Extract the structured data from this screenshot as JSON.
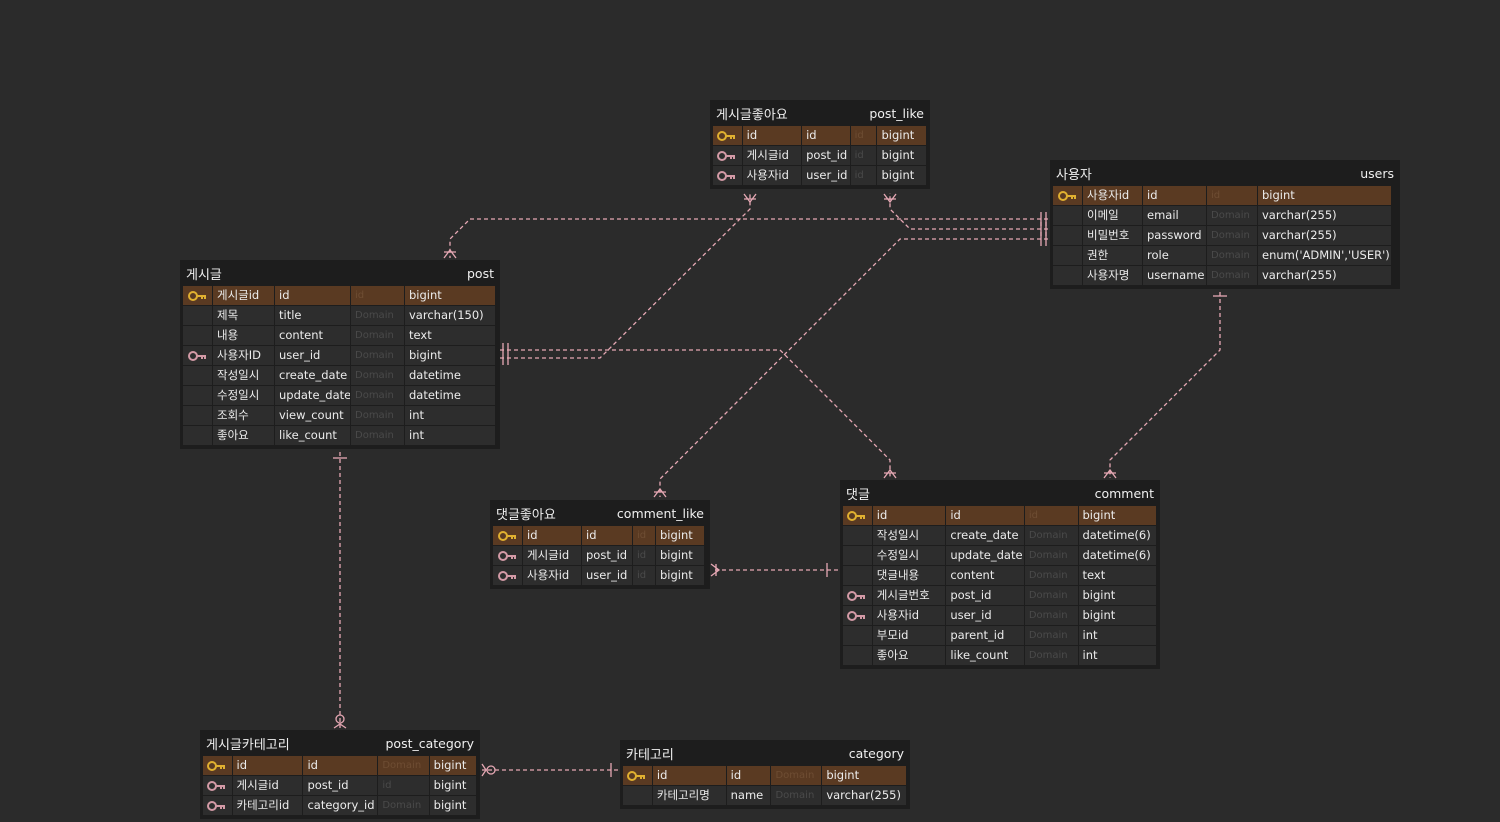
{
  "colors": {
    "background": "#2b2b2b",
    "pk_row": "#5a3a22",
    "relation_line": "#e6a8b4",
    "primary_key_icon": "#e0b030",
    "foreign_key_icon": "#d39aa6"
  },
  "icons": {
    "primary_key": "key-icon",
    "foreign_key": "foreign-key-icon"
  },
  "tables": [
    {
      "id": "post_like",
      "logical": "게시글좋아요",
      "physical": "post_like",
      "columns": [
        {
          "key": "pk",
          "logical": "id",
          "physical": "id",
          "domain": "id",
          "type": "bigint"
        },
        {
          "key": "fk",
          "logical": "게시글id",
          "physical": "post_id",
          "domain": "id",
          "type": "bigint"
        },
        {
          "key": "fk",
          "logical": "사용자id",
          "physical": "user_id",
          "domain": "id",
          "type": "bigint"
        }
      ]
    },
    {
      "id": "users",
      "logical": "사용자",
      "physical": "users",
      "columns": [
        {
          "key": "pk",
          "logical": "사용자id",
          "physical": "id",
          "domain": "id",
          "type": "bigint"
        },
        {
          "key": "",
          "logical": "이메일",
          "physical": "email",
          "domain": "Domain",
          "type": "varchar(255)"
        },
        {
          "key": "",
          "logical": "비밀번호",
          "physical": "password",
          "domain": "Domain",
          "type": "varchar(255)"
        },
        {
          "key": "",
          "logical": "권한",
          "physical": "role",
          "domain": "Domain",
          "type": "enum('ADMIN','USER')"
        },
        {
          "key": "",
          "logical": "사용자명",
          "physical": "username",
          "domain": "Domain",
          "type": "varchar(255)"
        }
      ]
    },
    {
      "id": "post",
      "logical": "게시글",
      "physical": "post",
      "columns": [
        {
          "key": "pk",
          "logical": "게시글id",
          "physical": "id",
          "domain": "id",
          "type": "bigint"
        },
        {
          "key": "",
          "logical": "제목",
          "physical": "title",
          "domain": "Domain",
          "type": "varchar(150)"
        },
        {
          "key": "",
          "logical": "내용",
          "physical": "content",
          "domain": "Domain",
          "type": "text"
        },
        {
          "key": "fk",
          "logical": "사용자ID",
          "physical": "user_id",
          "domain": "Domain",
          "type": "bigint"
        },
        {
          "key": "",
          "logical": "작성일시",
          "physical": "create_date",
          "domain": "Domain",
          "type": "datetime"
        },
        {
          "key": "",
          "logical": "수정일시",
          "physical": "update_date",
          "domain": "Domain",
          "type": "datetime"
        },
        {
          "key": "",
          "logical": "조회수",
          "physical": "view_count",
          "domain": "Domain",
          "type": "int"
        },
        {
          "key": "",
          "logical": "좋아요",
          "physical": "like_count",
          "domain": "Domain",
          "type": "int"
        }
      ]
    },
    {
      "id": "comment_like",
      "logical": "댓글좋아요",
      "physical": "comment_like",
      "columns": [
        {
          "key": "pk",
          "logical": "id",
          "physical": "id",
          "domain": "id",
          "type": "bigint"
        },
        {
          "key": "fk",
          "logical": "게시글id",
          "physical": "post_id",
          "domain": "id",
          "type": "bigint"
        },
        {
          "key": "fk",
          "logical": "사용자id",
          "physical": "user_id",
          "domain": "id",
          "type": "bigint"
        }
      ]
    },
    {
      "id": "comment",
      "logical": "댓글",
      "physical": "comment",
      "columns": [
        {
          "key": "pk",
          "logical": "id",
          "physical": "id",
          "domain": "id",
          "type": "bigint"
        },
        {
          "key": "",
          "logical": "작성일시",
          "physical": "create_date",
          "domain": "Domain",
          "type": "datetime(6)"
        },
        {
          "key": "",
          "logical": "수정일시",
          "physical": "update_date",
          "domain": "Domain",
          "type": "datetime(6)"
        },
        {
          "key": "",
          "logical": "댓글내용",
          "physical": "content",
          "domain": "Domain",
          "type": "text"
        },
        {
          "key": "fk",
          "logical": "게시글번호",
          "physical": "post_id",
          "domain": "Domain",
          "type": "bigint"
        },
        {
          "key": "fk",
          "logical": "사용자id",
          "physical": "user_id",
          "domain": "Domain",
          "type": "bigint"
        },
        {
          "key": "",
          "logical": "부모id",
          "physical": "parent_id",
          "domain": "Domain",
          "type": "int"
        },
        {
          "key": "",
          "logical": "좋아요",
          "physical": "like_count",
          "domain": "Domain",
          "type": "int"
        }
      ]
    },
    {
      "id": "post_category",
      "logical": "게시글카테고리",
      "physical": "post_category",
      "columns": [
        {
          "key": "pk",
          "logical": "id",
          "physical": "id",
          "domain": "Domain",
          "type": "bigint"
        },
        {
          "key": "fk",
          "logical": "게시글id",
          "physical": "post_id",
          "domain": "id",
          "type": "bigint"
        },
        {
          "key": "fk",
          "logical": "카테고리id",
          "physical": "category_id",
          "domain": "Domain",
          "type": "bigint"
        }
      ]
    },
    {
      "id": "category",
      "logical": "카테고리",
      "physical": "category",
      "columns": [
        {
          "key": "pk",
          "logical": "id",
          "physical": "id",
          "domain": "Domain",
          "type": "bigint"
        },
        {
          "key": "",
          "logical": "카테고리명",
          "physical": "name",
          "domain": "Domain",
          "type": "varchar(255)"
        }
      ]
    }
  ]
}
